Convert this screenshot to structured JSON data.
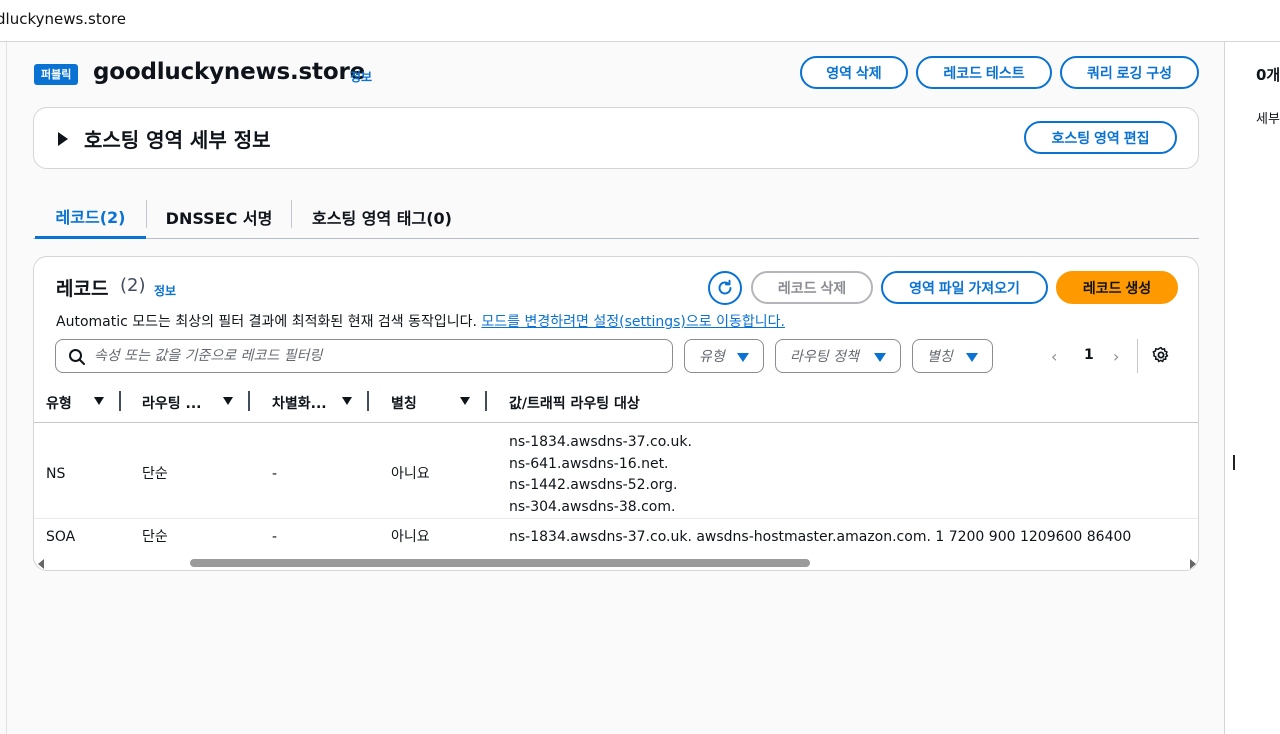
{
  "topbar": {
    "breadcrumb": "dluckynews.store"
  },
  "zone": {
    "badge": "퍼블릭",
    "name": "goodluckynews.store",
    "info": "정보"
  },
  "actions": {
    "delete_zone": "영역 삭제",
    "test_record": "레코드 테스트",
    "query_logging": "쿼리 로깅 구성"
  },
  "details": {
    "title": "호스팅 영역 세부 정보",
    "edit_button": "호스팅 영역 편집"
  },
  "tabs": [
    {
      "label": "레코드(2)",
      "active": true
    },
    {
      "label": "DNSSEC 서명",
      "active": false
    },
    {
      "label": "호스팅 영역 태그(0)",
      "active": false
    }
  ],
  "records": {
    "title": "레코드",
    "count": "(2)",
    "info": "정보",
    "delete_button": "레코드 삭제",
    "import_button": "영역 파일 가져오기",
    "create_button": "레코드 생성",
    "description": "Automatic 모드는 최상의 필터 결과에 최적화된 현재 검색 동작입니다.",
    "description_link": "모드를 변경하려면 설정(settings)으로 이동합니다.",
    "search_placeholder": "속성 또는 값을 기준으로 레코드 필터링",
    "filters": {
      "type": "유형",
      "routing": "라우팅 정책",
      "alias": "별칭"
    },
    "page": "1",
    "columns": [
      "유형",
      "라우팅 ...",
      "차별화...",
      "별칭",
      "값/트래픽 라우팅 대상"
    ],
    "rows": [
      {
        "type": "NS",
        "routing": "단순",
        "differentiator": "-",
        "alias": "아니요",
        "values": [
          "ns-1834.awsdns-37.co.uk.",
          "ns-641.awsdns-16.net.",
          "ns-1442.awsdns-52.org.",
          "ns-304.awsdns-38.com."
        ]
      },
      {
        "type": "SOA",
        "routing": "단순",
        "differentiator": "-",
        "alias": "아니요",
        "values": [
          "ns-1834.awsdns-37.co.uk. awsdns-hostmaster.amazon.com. 1 7200 900 1209600 86400"
        ]
      }
    ]
  },
  "right_panel": {
    "line1": "0개",
    "line2": "세부"
  },
  "colors": {
    "accent": "#0972d3",
    "primary": "#ff9900",
    "text": "#0f141a"
  }
}
